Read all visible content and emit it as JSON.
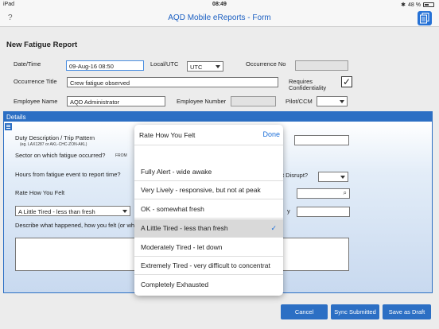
{
  "status": {
    "device": "iPad",
    "wifi": "wifi-icon",
    "time": "08:49",
    "battery": "48 %"
  },
  "nav": {
    "help": "?",
    "title": "AQD Mobile eReports - Form"
  },
  "form": {
    "title": "New Fatigue Report",
    "date_label": "Date/Time",
    "date_value": "09-Aug-16 08:50",
    "local_utc_label": "Local/UTC",
    "local_utc_value": "UTC",
    "occurrence_no_label": "Occurrence No",
    "occurrence_title_label": "Occurrence Title",
    "occurrence_title_value": "Crew fatigue observed",
    "requires_conf_label_1": "Requires",
    "requires_conf_label_2": "Confidentiality",
    "requires_conf_mark": "✓",
    "employee_name_label": "Employee Name",
    "employee_name_value": "AQD Administrator",
    "employee_number_label": "Employee Number",
    "pilot_ccm_label": "Pilot/CCM"
  },
  "details": {
    "header": "Details",
    "duty_label": "Duty Description / Trip Pattern",
    "duty_hint": "(eg. LAX1287 or AKL-CHC-ZON-AKL)",
    "sector_label": "Sector on which fatigue occurred?",
    "from_label": "FROM",
    "hours_label": "Hours from fatigue event to report time?",
    "disrupt_label": "t Disrupt?",
    "rate_label": "Rate How You Felt",
    "rate_value": "A Little Tired - less than fresh",
    "y_label": "y",
    "describe_label": "Describe what happened, how you felt (or wh"
  },
  "popover": {
    "title": "Rate How You Felt",
    "done": "Done",
    "options": [
      "Fully Alert - wide awake",
      "Very Lively - responsive, but not at peak",
      "OK - somewhat fresh",
      "A Little Tired - less than fresh",
      "Moderately Tired - let down",
      "Extremely Tired - very difficult to concentrat",
      "Completely Exhausted"
    ],
    "checkmark": "✓"
  },
  "buttons": {
    "cancel": "Cancel",
    "sync": "Sync Submitted",
    "save": "Save as Draft"
  },
  "colors": {
    "accent": "#2c6fc4",
    "title_blue": "#1b5fc2",
    "done_blue": "#1b6ed8"
  }
}
